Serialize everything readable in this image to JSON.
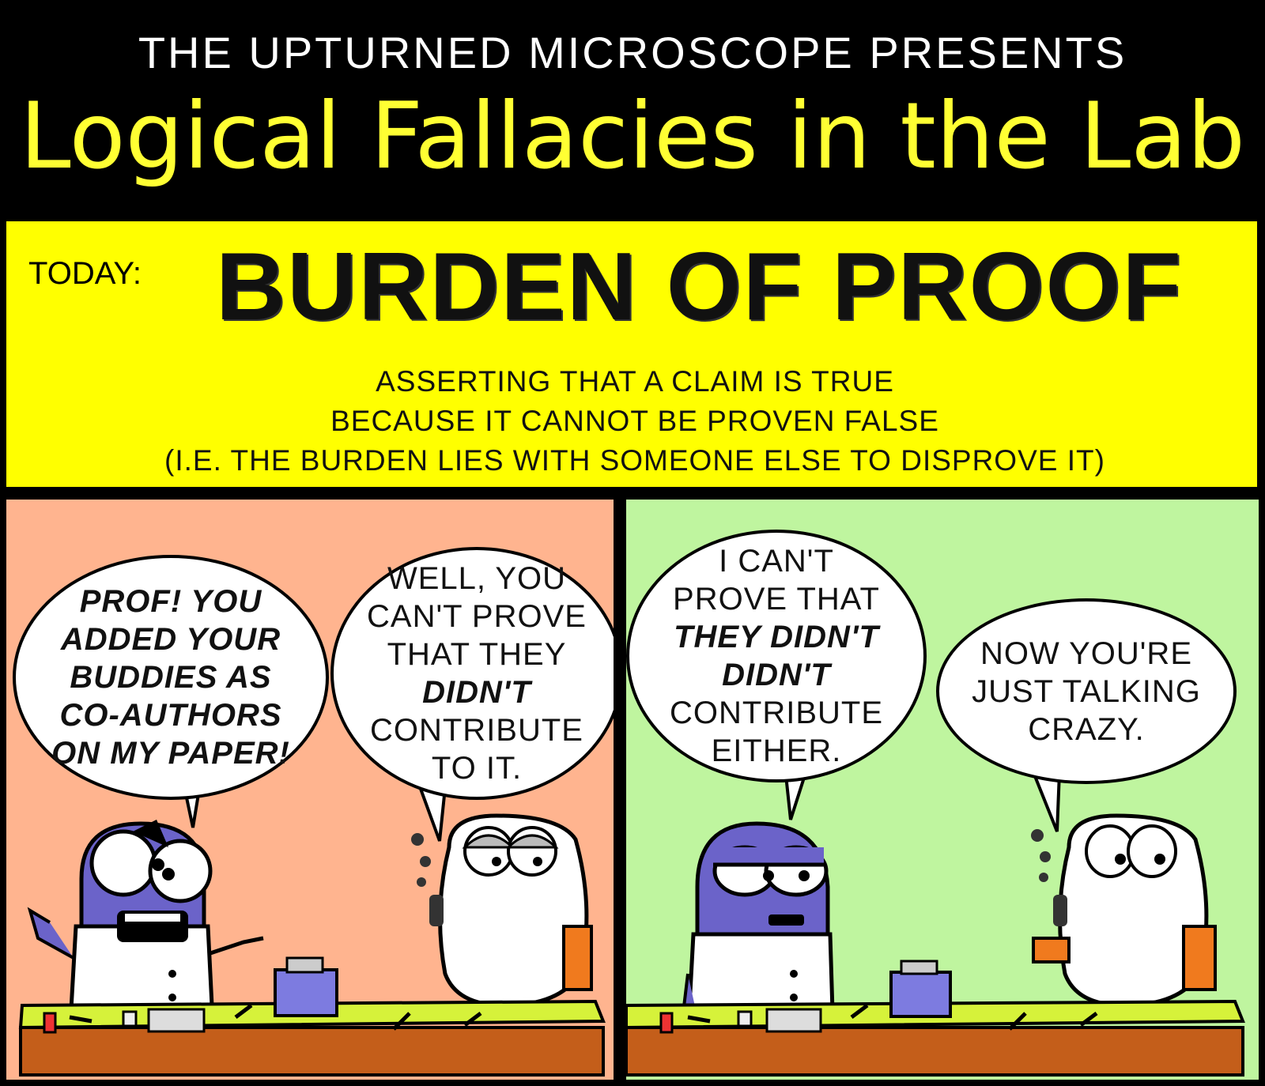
{
  "header": {
    "presents": "THE UPTURNED MICROSCOPE PRESENTS",
    "series_title": "Logical Fallacies in the Lab"
  },
  "topic": {
    "today_label": "TODAY:",
    "name": "BURDEN OF PROOF",
    "definition_lines": [
      "ASSERTING THAT A CLAIM IS TRUE",
      "BECAUSE IT CANNOT BE PROVEN FALSE",
      "(I.E. THE BURDEN LIES WITH SOMEONE ELSE TO DISPROVE IT)"
    ]
  },
  "panel1": {
    "student_speech": [
      "PROF! YOU",
      "ADDED YOUR",
      "BUDDIES AS",
      "CO-AUTHORS",
      "ON MY PAPER!"
    ],
    "prof_speech": [
      "WELL, YOU",
      "CAN'T PROVE",
      "THAT THEY",
      "DIDN'T",
      "CONTRIBUTE",
      "TO IT."
    ]
  },
  "panel2": {
    "student_speech": [
      "I CAN'T",
      "PROVE THAT",
      "THEY DIDN'T",
      "DIDN'T",
      "CONTRIBUTE",
      "EITHER."
    ],
    "prof_speech": [
      "NOW YOU'RE",
      "JUST TALKING",
      "CRAZY."
    ]
  },
  "colors": {
    "panel1_bg": "#ffb48f",
    "panel2_bg": "#bff59f",
    "topic_bg": "#ffff00",
    "title_color": "#ffff33",
    "bench": "#d6f23a",
    "student_body": "#6b63c9",
    "prof_robe": "#f07a1e"
  }
}
